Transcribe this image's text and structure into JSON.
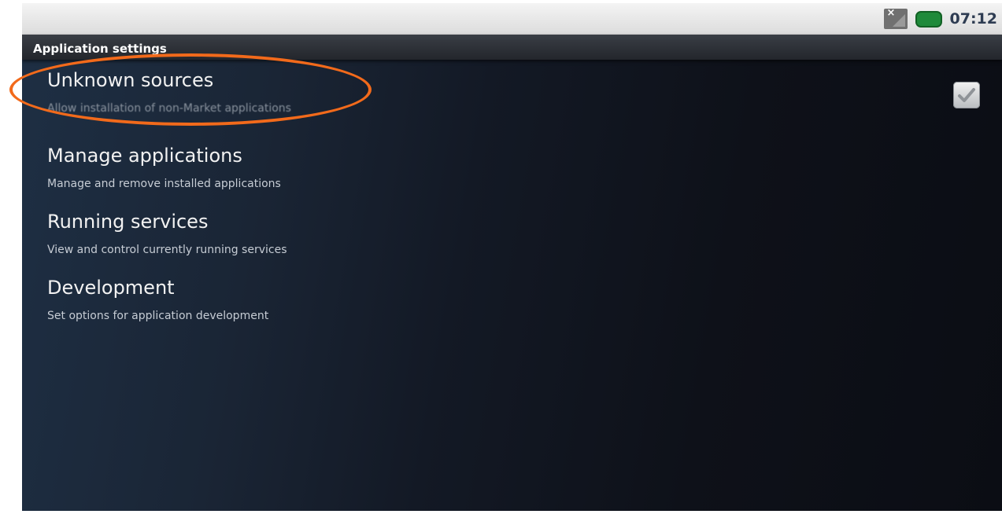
{
  "status_bar": {
    "time": "07:12",
    "icons": [
      "no-signal-icon",
      "battery-icon"
    ],
    "battery_color": "#1f8a3a"
  },
  "screen": {
    "title": "Application settings"
  },
  "settings": [
    {
      "title": "Unknown sources",
      "summary": "Allow installation of non-Market applications",
      "checked": true
    },
    {
      "title": "Manage applications",
      "summary": "Manage and remove installed applications"
    },
    {
      "title": "Running services",
      "summary": "View and control currently running services"
    },
    {
      "title": "Development",
      "summary": "Set options for application development"
    }
  ],
  "annotation": {
    "shape": "ellipse",
    "color": "#f26a1b",
    "target": "Unknown sources"
  }
}
